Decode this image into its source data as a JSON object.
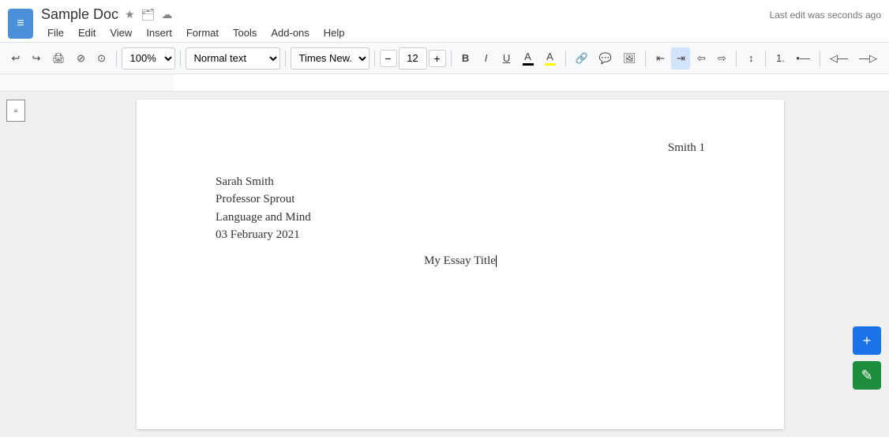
{
  "titleBar": {
    "appIcon": "docs-icon",
    "docTitle": "Sample Doc",
    "starIcon": "★",
    "folderIcon": "🗂",
    "cloudIcon": "☁",
    "menuItems": [
      "File",
      "Edit",
      "View",
      "Insert",
      "Format",
      "Tools",
      "Add-ons",
      "Help"
    ],
    "lastEdit": "Last edit was seconds ago"
  },
  "toolbar": {
    "undoLabel": "↩",
    "redoLabel": "↪",
    "printLabel": "🖨",
    "paintLabel": "⊘",
    "copyFormatLabel": "⊙",
    "zoomLevel": "100%",
    "textStyle": "Normal text",
    "fontFamily": "Times New...",
    "fontSizeMinus": "−",
    "fontSize": "12",
    "fontSizePlus": "+",
    "boldLabel": "B",
    "italicLabel": "I",
    "underlineLabel": "U",
    "textColorLabel": "A",
    "highlightLabel": "A",
    "linkLabel": "🔗",
    "imageLabel": "🖼",
    "alignLeftLabel": "≡",
    "alignCenterLabel": "≡",
    "alignRightLabel": "≡",
    "alignJustifyLabel": "≡",
    "lineSpacingLabel": "↕",
    "numberedListLabel": "1.",
    "bulletListLabel": "•",
    "indentDecLabel": "◁",
    "indentIncLabel": "▷"
  },
  "document": {
    "headerRight": "Smith 1",
    "lines": [
      {
        "text": "Sarah Smith",
        "align": "left"
      },
      {
        "text": "Professor Sprout",
        "align": "left"
      },
      {
        "text": "Language and Mind",
        "align": "left"
      },
      {
        "text": "03 February 2021",
        "align": "left"
      }
    ],
    "essayTitle": "My Essay Title",
    "cursor": true
  },
  "fab": {
    "addLabel": "+",
    "commentLabel": "✎"
  }
}
